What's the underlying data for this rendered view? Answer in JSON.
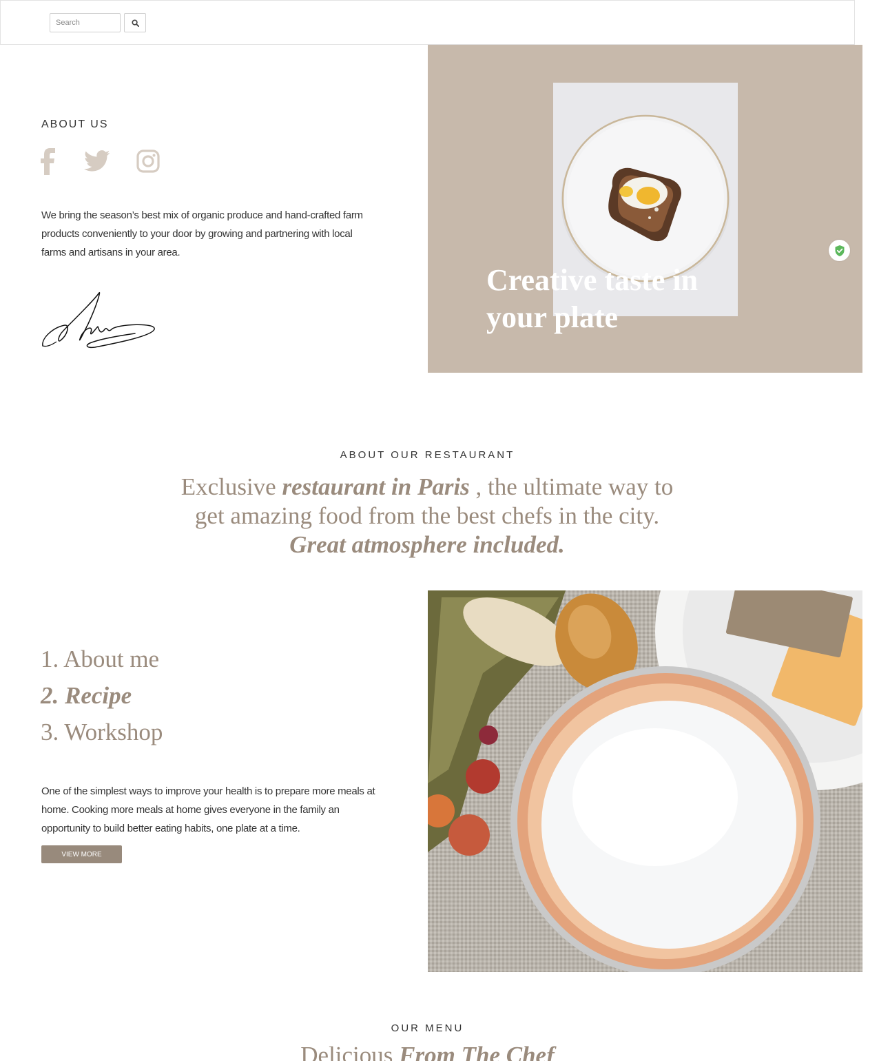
{
  "search": {
    "placeholder": "Search"
  },
  "about": {
    "heading": "ABOUT US",
    "social": [
      "facebook-icon",
      "twitter-icon",
      "instagram-icon"
    ],
    "text": "We bring the season’s best mix of organic produce and hand-crafted farm products conveniently to your door by growing and partnering with local farms and artisans in your area."
  },
  "hero": {
    "title": "Creative taste in your plate"
  },
  "restaurant": {
    "label": "ABOUT OUR RESTAURANT",
    "part1": "Exclusive ",
    "emphasis1": "restaurant in Paris",
    "part2": " , the ultimate way to get amazing food from the best chefs in the city. ",
    "emphasis2": "Great atmosphere included."
  },
  "steps": {
    "items": [
      "1. About me",
      "2. Recipe",
      "3. Workshop"
    ],
    "active_index": 1,
    "text": "One of the simplest ways to improve your health is to prepare more meals at home. Cooking more meals at home gives everyone in the family an opportunity to build better eating habits, one plate at a time.",
    "button_label": "VIEW MORE"
  },
  "menu": {
    "label": "OUR MENU",
    "title_plain": "Delicious ",
    "title_emphasis": "From The Chef"
  },
  "colors": {
    "accent": "#9a8b7d",
    "hero_bg": "#c7b9ab",
    "button_bg": "#988a7c",
    "social_icons": "#d6ccc2",
    "shield_green": "#5cb85c"
  }
}
